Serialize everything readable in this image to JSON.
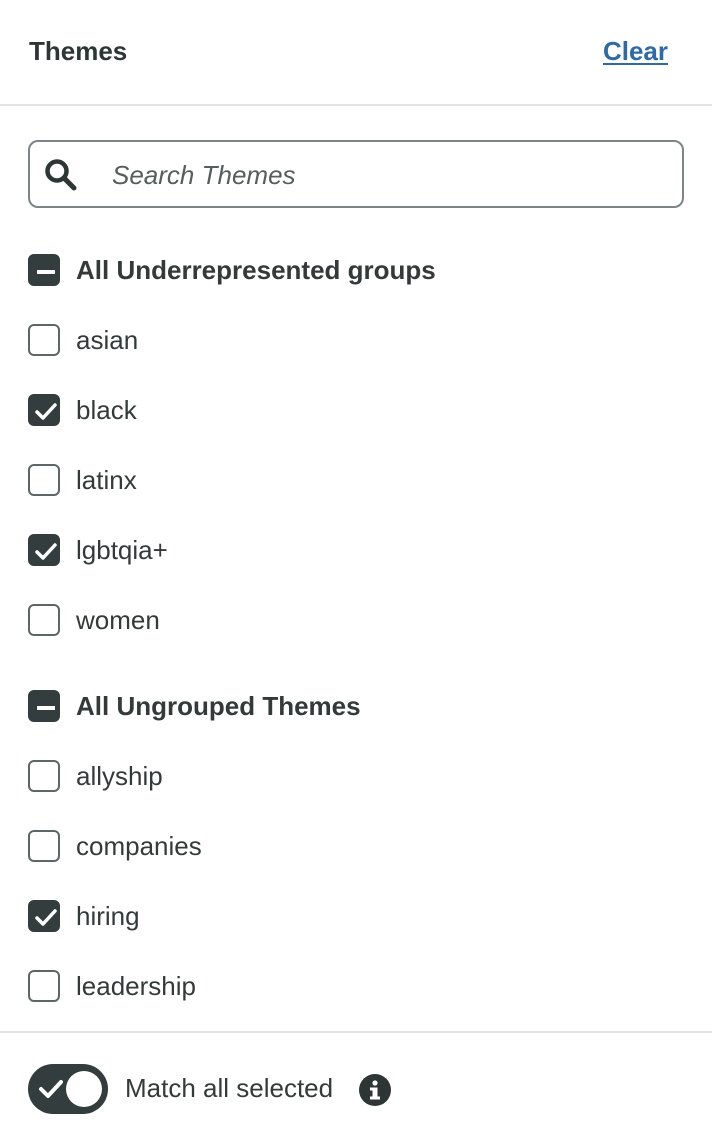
{
  "header": {
    "title": "Themes",
    "clear_label": "Clear"
  },
  "search": {
    "placeholder": "Search Themes",
    "value": ""
  },
  "groups": [
    {
      "label": "All Underrepresented groups",
      "state": "partial",
      "items": [
        {
          "label": "asian",
          "checked": false
        },
        {
          "label": "black",
          "checked": true
        },
        {
          "label": "latinx",
          "checked": false
        },
        {
          "label": "lgbtqia+",
          "checked": true
        },
        {
          "label": "women",
          "checked": false
        }
      ]
    },
    {
      "label": "All Ungrouped Themes",
      "state": "partial",
      "items": [
        {
          "label": "allyship",
          "checked": false
        },
        {
          "label": "companies",
          "checked": false
        },
        {
          "label": "hiring",
          "checked": true
        },
        {
          "label": "leadership",
          "checked": false
        }
      ]
    }
  ],
  "footer": {
    "toggle_label": "Match all selected",
    "toggle_on": true
  },
  "colors": {
    "accent": "#343d3d",
    "link": "#2f6aa8",
    "divider": "#e2e4e4"
  }
}
